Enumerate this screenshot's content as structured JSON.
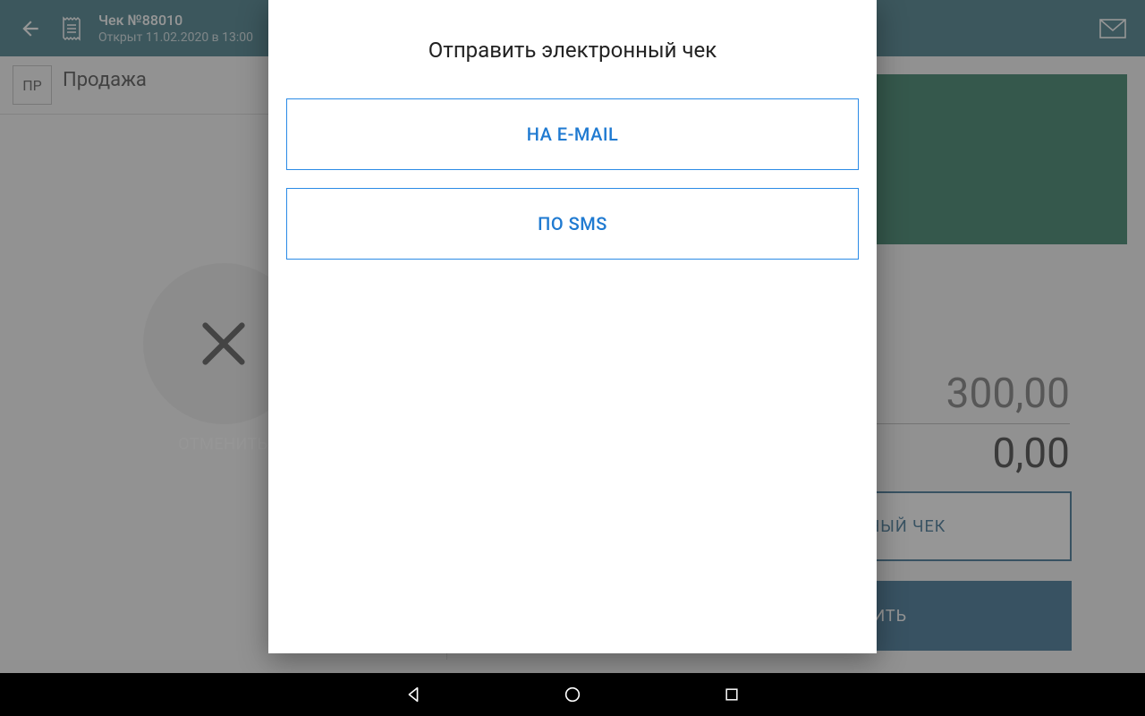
{
  "header": {
    "title": "Чек №88010",
    "subtitle": "Открыт 11.02.2020 в 13:00"
  },
  "left": {
    "badge": "ПР",
    "label": "Продажа",
    "cancel_label": "ОТМЕНИТЬ"
  },
  "right": {
    "amount_main": "300,00",
    "amount_sub": "0,00",
    "btn_outline": "ЭЛЕКТРОННЫЙ ЧЕК",
    "btn_solid": "ОПЛАТИТЬ"
  },
  "modal": {
    "title": "Отправить электронный чек",
    "btn_email": "НА E-MAIL",
    "btn_sms": "ПО SMS"
  }
}
